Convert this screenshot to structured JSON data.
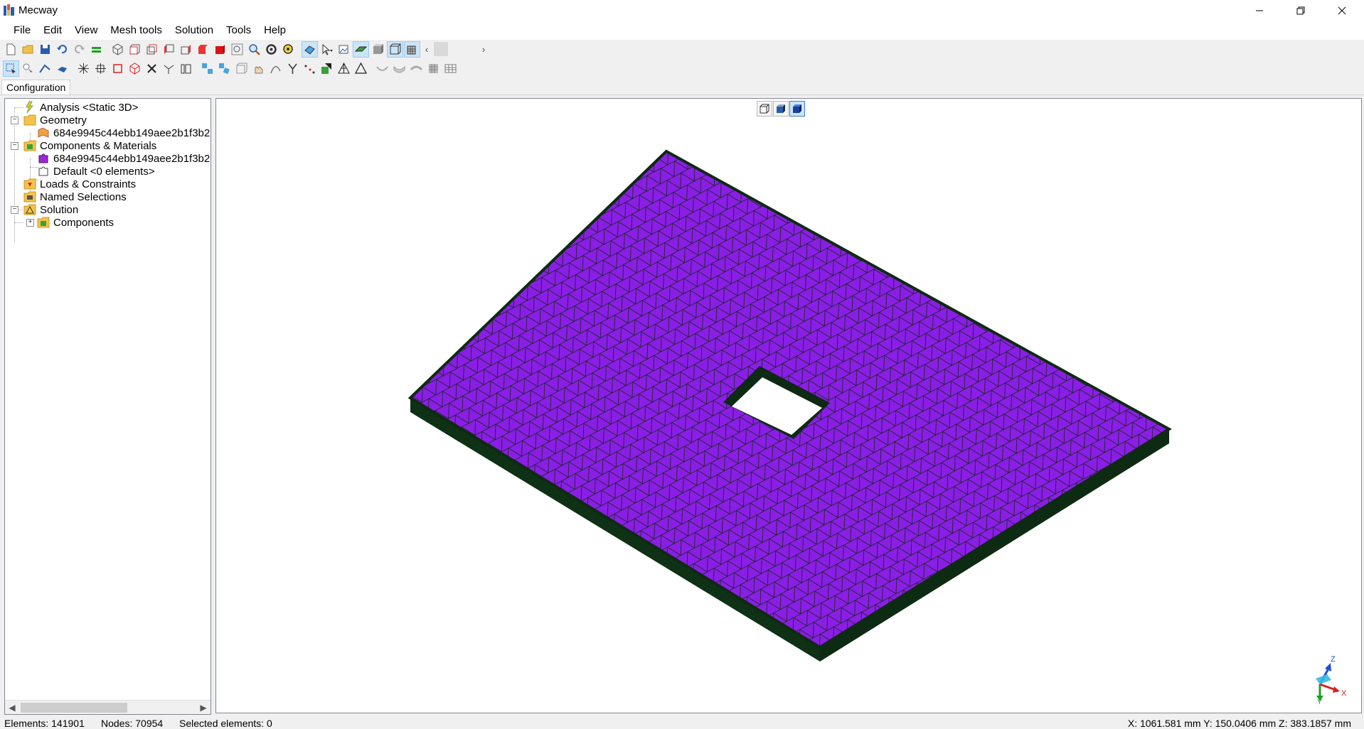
{
  "window": {
    "title": "Mecway",
    "controls": [
      "minimize-icon",
      "restore-icon",
      "close-icon"
    ]
  },
  "menu": [
    "File",
    "Edit",
    "View",
    "Mesh tools",
    "Solution",
    "Tools",
    "Help"
  ],
  "config_tab": "Configuration",
  "tree": {
    "analysis": "Analysis <Static 3D>",
    "geometry": "Geometry",
    "geometry_item": "684e9945c44ebb149aee2b1f3b2",
    "components_materials": "Components & Materials",
    "component_item": "684e9945c44ebb149aee2b1f3b2",
    "default_component": "Default <0 elements>",
    "loads": "Loads & Constraints",
    "named_selections": "Named Selections",
    "solution": "Solution",
    "solution_components": "Components"
  },
  "status": {
    "elements": "Elements: 141901",
    "nodes": "Nodes: 70954",
    "selected": "Selected elements: 0",
    "coords": "X: 1061.581 mm Y: 150.0406 mm Z: 383.1857 mm"
  },
  "triad": {
    "x": "X",
    "y": "Y",
    "z": "Z"
  },
  "colors": {
    "mesh_fill": "#8a1ee6",
    "mesh_edges": "#0d2a12",
    "accent": "#cce4f7"
  }
}
